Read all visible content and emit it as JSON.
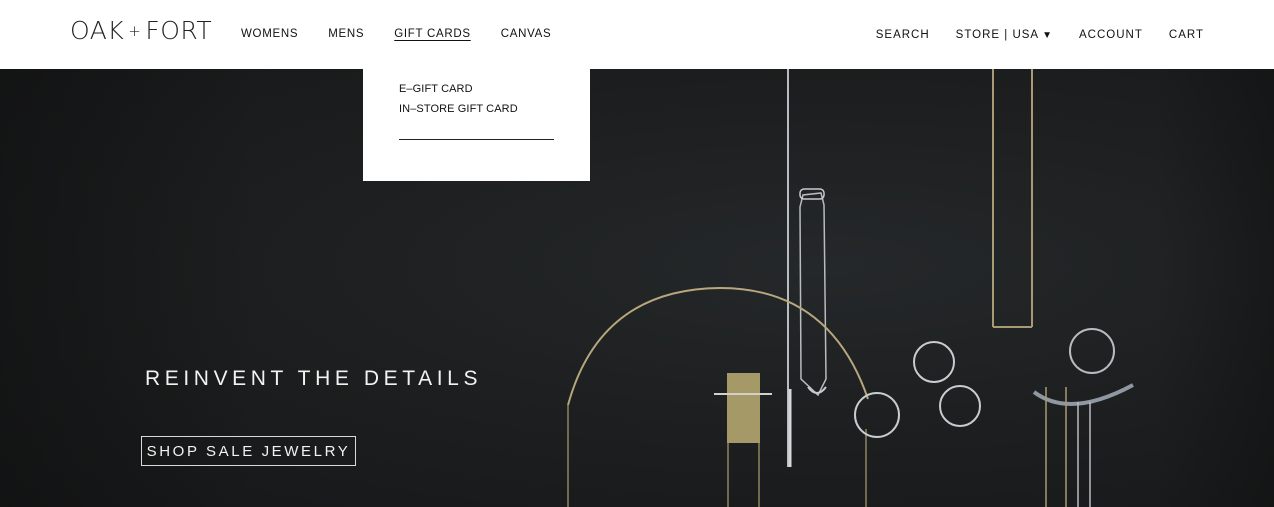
{
  "brand": {
    "logo_left": "OAK",
    "logo_plus": "+",
    "logo_right": "FORT"
  },
  "nav_left": [
    {
      "label": "WOMENS"
    },
    {
      "label": "MENS"
    },
    {
      "label": "GIFT CARDS"
    },
    {
      "label": "CANVAS"
    }
  ],
  "nav_right": {
    "search": "SEARCH",
    "store": "STORE | USA",
    "store_caret": "▼",
    "account": "ACCOUNT",
    "cart": "CART"
  },
  "dropdown": {
    "items": [
      {
        "label": "E–GIFT CARD"
      },
      {
        "label": "IN–STORE GIFT CARD"
      }
    ]
  },
  "hero": {
    "headline": "REINVENT THE DETAILS",
    "cta": "SHOP SALE JEWELRY",
    "image": "jewelry-on-black-background"
  },
  "colors": {
    "hero_bg": "#1d1f20",
    "text_light": "#f2f2f2",
    "gold": "#b7a77c",
    "silver": "#b9bcbf"
  }
}
